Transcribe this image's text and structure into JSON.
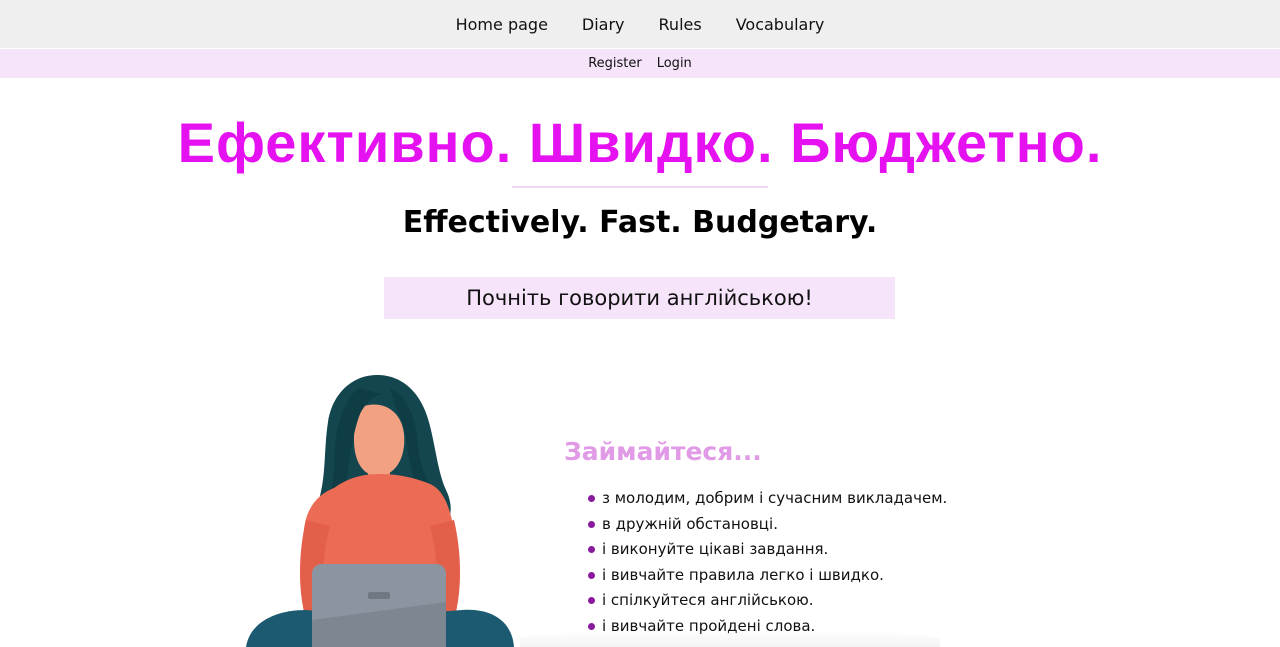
{
  "nav": {
    "items": [
      {
        "label": "Home page"
      },
      {
        "label": "Diary"
      },
      {
        "label": "Rules"
      },
      {
        "label": "Vocabulary"
      }
    ]
  },
  "auth": {
    "register": "Register",
    "login": "Login"
  },
  "hero": {
    "title": "Ефективно. Швидко. Бюджетно.",
    "subtitle": "Effectively. Fast. Budgetary.",
    "cta": "Почніть говорити англійською!"
  },
  "study": {
    "heading": "Займайтеся...",
    "items": [
      "з молодим, добрим і сучасним викладачем.",
      "в дружній обстановці.",
      "і виконуйте цікаві завдання.",
      "і вивчайте правила легко і швидко.",
      "і спілкуйтеся англійською.",
      "і вивчайте пройдені слова."
    ]
  },
  "colors": {
    "title_magenta": "#e611f0",
    "pink_band": "#f6e4fb",
    "heading_pink": "#e09ae6",
    "bullet_purple": "#8a1a9c"
  },
  "icons": {
    "illustration": "woman-with-laptop-illustration"
  }
}
